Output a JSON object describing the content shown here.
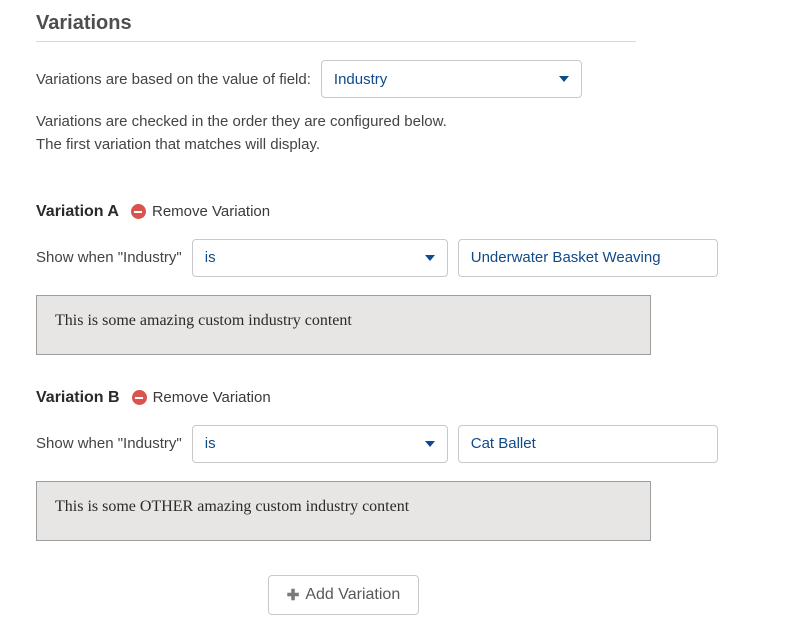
{
  "section": {
    "title": "Variations",
    "based_on_label": "Variations are based on the value of field:",
    "field_select_value": "Industry",
    "helper_line1": "Variations are checked in the order they are configured below.",
    "helper_line2": "The first variation that matches will display."
  },
  "remove_label": "Remove Variation",
  "show_when_prefix": "Show when \"Industry\"",
  "variations": [
    {
      "title": "Variation A",
      "operator": "is",
      "value": "Underwater Basket Weaving",
      "content": "This is some amazing custom industry content"
    },
    {
      "title": "Variation B",
      "operator": "is",
      "value": "Cat Ballet",
      "content": "This is some OTHER amazing custom industry content"
    }
  ],
  "add_button": "Add Variation"
}
